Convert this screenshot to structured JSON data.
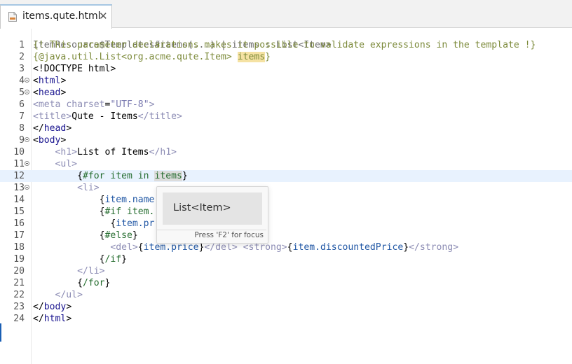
{
  "tab": {
    "title": "items.qute.html",
    "close": "✕",
    "icon": "html-file-icon"
  },
  "editor": {
    "header_hint": "ItemResource$Templates#items(...) | items : List<Item>",
    "lines": [
      {
        "n": "1",
        "parts": [
          {
            "t": "{! This parameter declarations makes it possible to validate expressions in the template !}",
            "c": "cmt"
          }
        ]
      },
      {
        "n": "2",
        "parts": [
          {
            "t": "{@java.util.List<org.acme.qute.Item> ",
            "c": "cmt"
          },
          {
            "t": "items",
            "c": "cmt hl-yellow"
          },
          {
            "t": "}",
            "c": "cmt"
          }
        ]
      },
      {
        "n": "3",
        "parts": [
          {
            "t": "<!DOCTYPE html>",
            "c": ""
          }
        ]
      },
      {
        "n": "4",
        "fold": true,
        "parts": [
          {
            "t": "<",
            "c": ""
          },
          {
            "t": "html",
            "c": "tag"
          },
          {
            "t": ">",
            "c": ""
          }
        ]
      },
      {
        "n": "5",
        "fold": true,
        "parts": [
          {
            "t": "<",
            "c": ""
          },
          {
            "t": "head",
            "c": "tag"
          },
          {
            "t": ">",
            "c": ""
          }
        ]
      },
      {
        "n": "6",
        "parts": [
          {
            "t": "<meta ",
            "c": "tagd"
          },
          {
            "t": "charset",
            "c": "attr"
          },
          {
            "t": "=",
            "c": ""
          },
          {
            "t": "\"UTF-8\"",
            "c": "str"
          },
          {
            "t": ">",
            "c": "tagd"
          }
        ]
      },
      {
        "n": "7",
        "parts": [
          {
            "t": "<title>",
            "c": "tagd"
          },
          {
            "t": "Qute - Items",
            "c": ""
          },
          {
            "t": "</title>",
            "c": "tagd"
          }
        ]
      },
      {
        "n": "8",
        "parts": [
          {
            "t": "</",
            "c": ""
          },
          {
            "t": "head",
            "c": "tag"
          },
          {
            "t": ">",
            "c": ""
          }
        ]
      },
      {
        "n": "9",
        "fold": true,
        "parts": [
          {
            "t": "<",
            "c": ""
          },
          {
            "t": "body",
            "c": "tag"
          },
          {
            "t": ">",
            "c": ""
          }
        ]
      },
      {
        "n": "10",
        "parts": [
          {
            "t": "    <h1>",
            "c": "tagd"
          },
          {
            "t": "List of Items",
            "c": ""
          },
          {
            "t": "</h1>",
            "c": "tagd"
          }
        ]
      },
      {
        "n": "11",
        "fold": true,
        "parts": [
          {
            "t": "    <ul>",
            "c": "tagd"
          }
        ]
      },
      {
        "n": "12",
        "current": true,
        "parts": [
          {
            "t": "        {",
            "c": ""
          },
          {
            "t": "#for item in ",
            "c": "qute"
          },
          {
            "t": "items",
            "c": "qute hl-grey"
          },
          {
            "t": "}",
            "c": ""
          }
        ]
      },
      {
        "n": "13",
        "fold": true,
        "parts": [
          {
            "t": "        <li>",
            "c": "tagd"
          }
        ]
      },
      {
        "n": "14",
        "parts": [
          {
            "t": "            {",
            "c": ""
          },
          {
            "t": "item.name",
            "c": "var"
          }
        ]
      },
      {
        "n": "15",
        "parts": [
          {
            "t": "            {",
            "c": ""
          },
          {
            "t": "#if item.",
            "c": "qute"
          }
        ]
      },
      {
        "n": "16",
        "parts": [
          {
            "t": "              {",
            "c": ""
          },
          {
            "t": "item.pr",
            "c": "var"
          }
        ]
      },
      {
        "n": "17",
        "parts": [
          {
            "t": "            {",
            "c": ""
          },
          {
            "t": "#else",
            "c": "qute"
          },
          {
            "t": "}",
            "c": ""
          }
        ]
      },
      {
        "n": "18",
        "parts": [
          {
            "t": "              <del>",
            "c": "tagd"
          },
          {
            "t": "{",
            "c": ""
          },
          {
            "t": "item.price",
            "c": "var"
          },
          {
            "t": "}",
            "c": ""
          },
          {
            "t": "</del> ",
            "c": "tagd"
          },
          {
            "t": "<strong>",
            "c": "tagd"
          },
          {
            "t": "{",
            "c": ""
          },
          {
            "t": "item.discountedPrice",
            "c": "var"
          },
          {
            "t": "}",
            "c": ""
          },
          {
            "t": "</strong>",
            "c": "tagd"
          }
        ]
      },
      {
        "n": "19",
        "parts": [
          {
            "t": "            {",
            "c": ""
          },
          {
            "t": "/if",
            "c": "qute"
          },
          {
            "t": "}",
            "c": ""
          }
        ]
      },
      {
        "n": "20",
        "parts": [
          {
            "t": "        </li>",
            "c": "tagd"
          }
        ]
      },
      {
        "n": "21",
        "parts": [
          {
            "t": "        {",
            "c": ""
          },
          {
            "t": "/for",
            "c": "qute"
          },
          {
            "t": "}",
            "c": ""
          }
        ]
      },
      {
        "n": "22",
        "parts": [
          {
            "t": "    </ul>",
            "c": "tagd"
          }
        ]
      },
      {
        "n": "23",
        "parts": [
          {
            "t": "</",
            "c": ""
          },
          {
            "t": "body",
            "c": "tag"
          },
          {
            "t": ">",
            "c": ""
          }
        ]
      },
      {
        "n": "24",
        "parts": [
          {
            "t": "</",
            "c": ""
          },
          {
            "t": "html",
            "c": "tag"
          },
          {
            "t": ">",
            "c": ""
          }
        ]
      }
    ]
  },
  "hover": {
    "type_text": "List<Item>",
    "footer": "Press 'F2' for focus"
  }
}
